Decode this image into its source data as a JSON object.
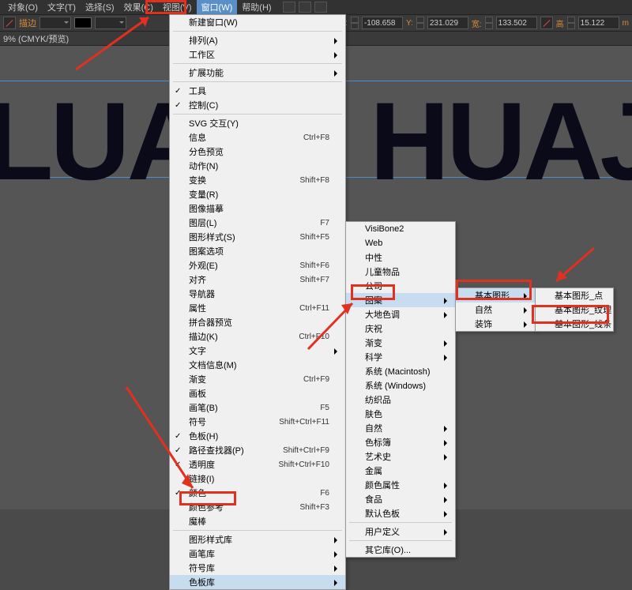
{
  "menubar": {
    "items": [
      {
        "label": "对象(O)"
      },
      {
        "label": "文字(T)"
      },
      {
        "label": "选择(S)"
      },
      {
        "label": "效果(C)"
      },
      {
        "label": "视图(V)"
      },
      {
        "label": "窗口(W)"
      },
      {
        "label": "帮助(H)"
      }
    ]
  },
  "toolbar": {
    "stroke_label": "描边",
    "x_label": "X:",
    "x_val": "-108.658",
    "y_label": "Y:",
    "y_val": "231.029",
    "w_label": "宽:",
    "w_val": "133.502",
    "h_label": "高",
    "h_val": "15.122",
    "unit": "m"
  },
  "subbar": {
    "text": "9% (CMYK/预览)"
  },
  "canvas": {
    "left": "LUA",
    "right": "HUAJ"
  },
  "menu1": [
    {
      "t": "新建窗口(W)"
    },
    {
      "sep": 1
    },
    {
      "t": "排列(A)",
      "sub": 1
    },
    {
      "t": "工作区",
      "sub": 1
    },
    {
      "sep": 1
    },
    {
      "t": "扩展功能",
      "sub": 1
    },
    {
      "sep": 1
    },
    {
      "t": "工具",
      "chk": 1
    },
    {
      "t": "控制(C)",
      "chk": 1
    },
    {
      "sep": 1
    },
    {
      "t": "SVG 交互(Y)"
    },
    {
      "t": "信息",
      "sc": "Ctrl+F8"
    },
    {
      "t": "分色预览"
    },
    {
      "t": "动作(N)"
    },
    {
      "t": "变换",
      "sc": "Shift+F8"
    },
    {
      "t": "变量(R)"
    },
    {
      "t": "图像描摹"
    },
    {
      "t": "图层(L)",
      "sc": "F7"
    },
    {
      "t": "图形样式(S)",
      "sc": "Shift+F5"
    },
    {
      "t": "图案选项"
    },
    {
      "t": "外观(E)",
      "sc": "Shift+F6"
    },
    {
      "t": "对齐",
      "sc": "Shift+F7"
    },
    {
      "t": "导航器"
    },
    {
      "t": "属性",
      "sc": "Ctrl+F11"
    },
    {
      "t": "拼合器预览"
    },
    {
      "t": "描边(K)",
      "sc": "Ctrl+F10"
    },
    {
      "t": "文字",
      "sub": 1
    },
    {
      "t": "文档信息(M)"
    },
    {
      "t": "渐变",
      "sc": "Ctrl+F9"
    },
    {
      "t": "画板"
    },
    {
      "t": "画笔(B)",
      "sc": "F5"
    },
    {
      "t": "符号",
      "sc": "Shift+Ctrl+F11"
    },
    {
      "t": "色板(H)",
      "chk": 1
    },
    {
      "t": "路径查找器(P)",
      "sc": "Shift+Ctrl+F9",
      "chk": 1
    },
    {
      "t": "透明度",
      "sc": "Shift+Ctrl+F10",
      "chk": 1
    },
    {
      "t": "链接(I)"
    },
    {
      "t": "颜色",
      "sc": "F6",
      "chk": 1
    },
    {
      "t": "颜色参考",
      "sc": "Shift+F3"
    },
    {
      "t": "魔棒"
    },
    {
      "sep": 1
    },
    {
      "t": "图形样式库",
      "sub": 1
    },
    {
      "t": "画笔库",
      "sub": 1
    },
    {
      "t": "符号库",
      "sub": 1
    },
    {
      "t": "色板库",
      "sub": 1,
      "hov": 1
    }
  ],
  "menu2": [
    {
      "t": "VisiBone2"
    },
    {
      "t": "Web"
    },
    {
      "t": "中性"
    },
    {
      "t": "儿童物品"
    },
    {
      "t": "公司"
    },
    {
      "t": "图案",
      "sub": 1,
      "hov": 1
    },
    {
      "t": "大地色调",
      "sub": 1
    },
    {
      "t": "庆祝"
    },
    {
      "t": "渐变",
      "sub": 1
    },
    {
      "t": "科学",
      "sub": 1
    },
    {
      "t": "系统 (Macintosh)"
    },
    {
      "t": "系统 (Windows)"
    },
    {
      "t": "纺织品"
    },
    {
      "t": "肤色"
    },
    {
      "t": "自然",
      "sub": 1
    },
    {
      "t": "色标簿",
      "sub": 1
    },
    {
      "t": "艺术史",
      "sub": 1
    },
    {
      "t": "金属"
    },
    {
      "t": "颜色属性",
      "sub": 1
    },
    {
      "t": "食品",
      "sub": 1
    },
    {
      "t": "默认色板",
      "sub": 1
    },
    {
      "sep": 1
    },
    {
      "t": "用户定义",
      "sub": 1
    },
    {
      "sep": 1
    },
    {
      "t": "其它库(O)..."
    }
  ],
  "menu3": [
    {
      "t": "基本图形",
      "sub": 1,
      "hov": 1
    },
    {
      "t": "自然",
      "sub": 1
    },
    {
      "t": "装饰",
      "sub": 1
    }
  ],
  "menu4": [
    {
      "t": "基本图形_点"
    },
    {
      "t": "基本图形_纹理"
    },
    {
      "t": "基本图形_线条"
    }
  ]
}
